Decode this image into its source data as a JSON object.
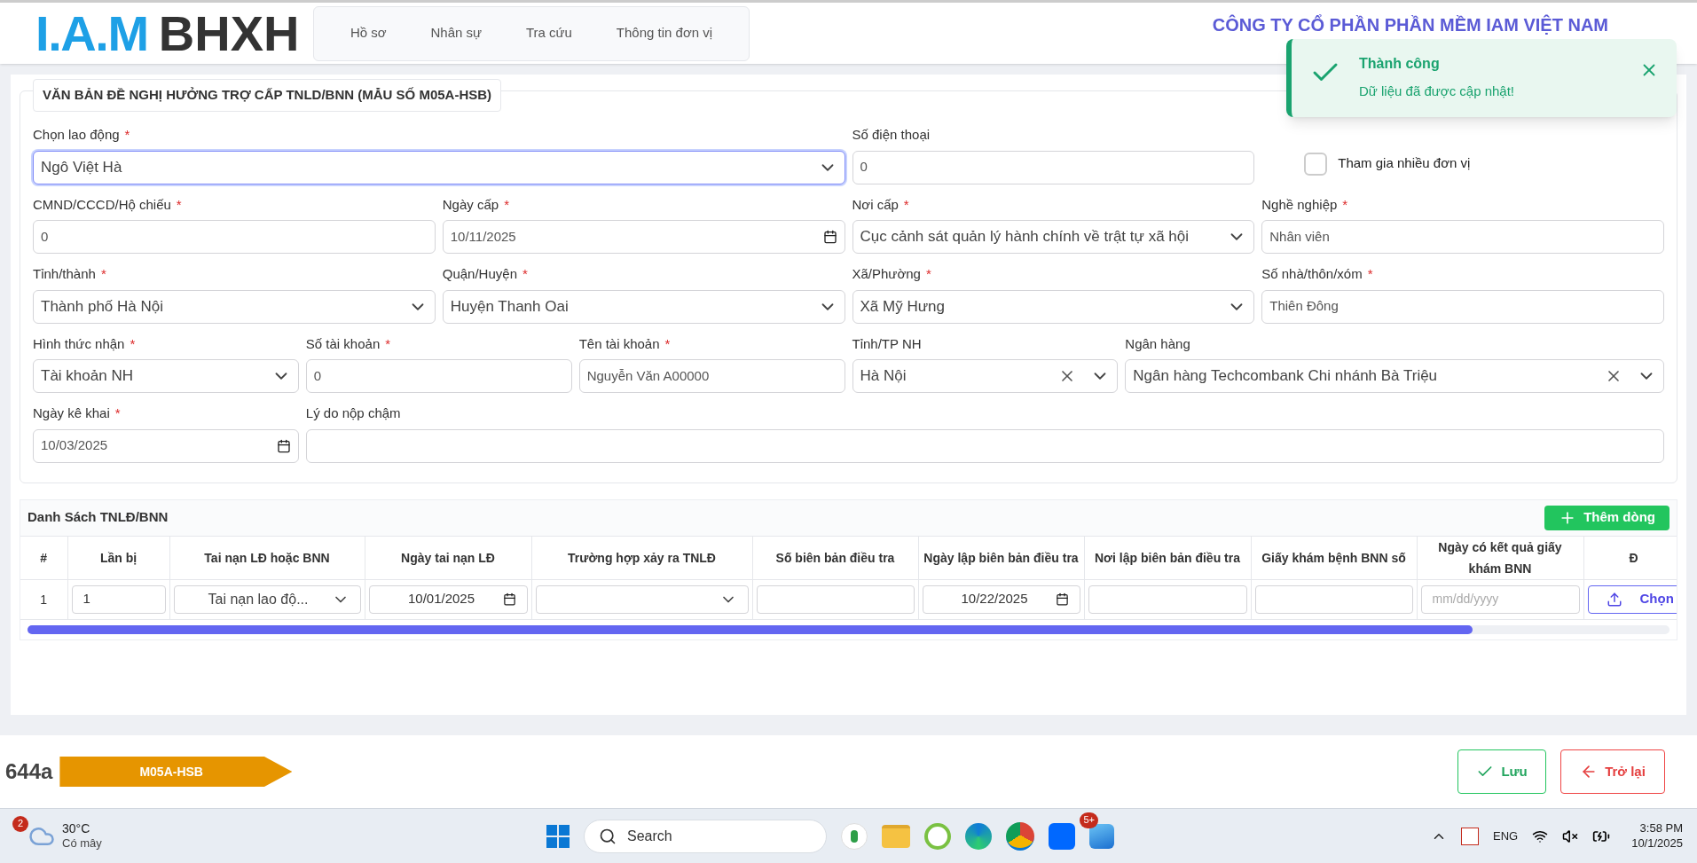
{
  "header": {
    "logo_left": "I.A.M",
    "logo_right": "BHXH",
    "nav": [
      {
        "label": "Hồ sơ",
        "selected": false
      },
      {
        "label": "Nhân sự",
        "selected": false
      },
      {
        "label": "Tra cứu",
        "selected": false
      },
      {
        "label": "Thông tin đơn vị",
        "selected": false
      }
    ],
    "company": "CÔNG TY CỔ PHẦN PHẦN MỀM IAM VIỆT NAM"
  },
  "toast": {
    "title": "Thành công",
    "message": "Dữ liệu đã được cập nhật!"
  },
  "form": {
    "title": "VĂN BẢN ĐỀ NGHỊ HƯỞNG TRỢ CẤP TNLD/BNN (MẪU SỐ M05A-HSB)",
    "fields": [
      {
        "label": "Chọn lao động",
        "required_mark": "*",
        "kind": "select",
        "value": "Ngô Việt Hà",
        "focused": true
      },
      {
        "label": "Số điện thoại",
        "kind": "text",
        "value": "0",
        "focused": false
      },
      {
        "kind": "checkbox",
        "label": "Tham gia nhiều đơn vị",
        "checked": false
      },
      {
        "label": "CMND/CCCD/Hộ chiếu",
        "required_mark": "*",
        "kind": "text",
        "value": "0",
        "focused": false
      },
      {
        "label": "Ngày cấp",
        "required_mark": "*",
        "kind": "date",
        "value": "10/11/2025",
        "focused": false
      },
      {
        "label": "Nơi cấp",
        "required_mark": "*",
        "kind": "select",
        "value": "Cục cảnh sát quản lý hành chính về trật tự xã hội",
        "focused": false
      },
      {
        "label": "Nghề nghiệp",
        "required_mark": "*",
        "kind": "text",
        "value": "Nhân viên",
        "focused": false
      },
      {
        "label": "Tỉnh/thành",
        "required_mark": "*",
        "kind": "select",
        "value": "Thành phố Hà Nội",
        "focused": false
      },
      {
        "label": "Quận/Huyện",
        "required_mark": "*",
        "kind": "select",
        "value": "Huyện Thanh Oai",
        "focused": false
      },
      {
        "label": "Xã/Phường",
        "required_mark": "*",
        "kind": "select",
        "value": "Xã Mỹ Hưng",
        "focused": false
      },
      {
        "label": "Số nhà/thôn/xóm",
        "required_mark": "*",
        "kind": "text",
        "value": "Thiên Đông",
        "focused": false
      },
      {
        "label": "Hình thức nhận",
        "required_mark": "*",
        "kind": "select",
        "value": "Tài khoản NH",
        "focused": false
      },
      {
        "label": "Số tài khoản",
        "required_mark": "*",
        "kind": "text",
        "value": "0",
        "focused": false
      },
      {
        "label": "Tên tài khoản",
        "required_mark": "*",
        "kind": "text",
        "value": "Nguyễn Văn A00000",
        "focused": false
      },
      {
        "label": "Tỉnh/TP NH",
        "kind": "clearable",
        "value": "Hà Nội",
        "focused": false
      },
      {
        "label": "Ngân hàng",
        "kind": "clearable",
        "value": "Ngân hàng Techcombank Chi nhánh Bà Triệu",
        "focused": false
      },
      {
        "label": "Ngày kê khai",
        "required_mark": "*",
        "kind": "date",
        "value": "10/03/2025",
        "focused": false
      },
      {
        "label": "Lý do nộp chậm",
        "kind": "text",
        "focused": false
      }
    ]
  },
  "table": {
    "title": "Danh Sách TNLĐ/BNN",
    "add_button": "Thêm dòng",
    "columns": [
      "#",
      "Lần bị",
      "Tai nạn LĐ hoặc BNN",
      "Ngày tai nạn LĐ",
      "Trường hợp xảy ra TNLĐ",
      "Số biên bản điều tra",
      "Ngày lập biên bản điều tra",
      "Nơi lập biên bản điều tra",
      "Giấy khám bệnh BNN số",
      "Ngày có kết quả giấy khám BNN",
      "Đ"
    ],
    "rows": [
      {
        "cells": [
          {
            "kind": "index",
            "value": "1"
          },
          {
            "kind": "text",
            "value": "1"
          },
          {
            "kind": "select",
            "value": "Tai nạn lao độ..."
          },
          {
            "kind": "date",
            "value": "10/01/2025"
          },
          {
            "kind": "select"
          },
          {
            "kind": "text"
          },
          {
            "kind": "date",
            "value": "10/22/2025"
          },
          {
            "kind": "text"
          },
          {
            "kind": "text"
          },
          {
            "kind": "date",
            "placeholder": "mm/dd/yyyy"
          },
          {
            "kind": "upload",
            "value": "Chọn"
          }
        ]
      }
    ]
  },
  "footer": {
    "code": "644a",
    "tag": "M05A-HSB",
    "buttons": [
      {
        "kind": "save",
        "label": "Lưu"
      },
      {
        "kind": "back",
        "label": "Trở lại"
      }
    ]
  },
  "taskbar": {
    "weather_badge": "2",
    "temperature": "30°C",
    "condition": "Có mây",
    "search": "Search",
    "zalo_badge": "5+",
    "language": "ENG",
    "time": "3:58 PM",
    "date": "10/1/2025"
  }
}
